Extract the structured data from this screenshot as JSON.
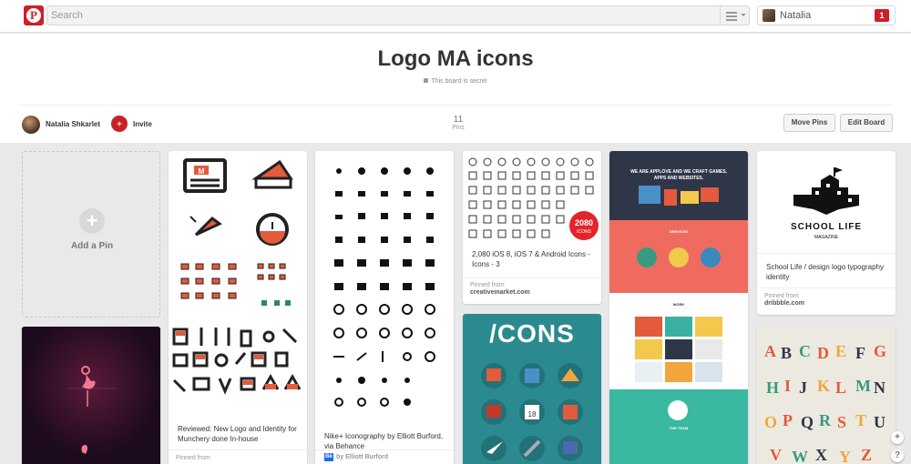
{
  "topbar": {
    "logo_letter": "P",
    "search_placeholder": "Search",
    "user_name": "Natalia",
    "notification_count": "1"
  },
  "board": {
    "title": "Logo MA icons",
    "secret_note": "This board is secret",
    "owner_name": "Natalia Shkarlet",
    "invite_label": "Invite",
    "pins_count": "11",
    "pins_label": "Pins",
    "move_pins_label": "Move Pins",
    "edit_board_label": "Edit Board"
  },
  "add_pin": {
    "label": "Add a Pin",
    "plus": "+"
  },
  "pins": [
    {
      "desc": "Reviewed: New Logo and Identity for Munchery done In-house",
      "pinned_from_label": "Pinned from",
      "source": ""
    },
    {
      "desc": "Nike+ Iconography by Elliott Burford, via Behance",
      "source": "by Elliott Burford",
      "source_badge": "Bē"
    },
    {
      "desc": "2,080 iOS 8, iOS 7 & Android Icons - Icons - 3",
      "pinned_from_label": "Pinned from",
      "source": "creativemarket.com",
      "badge_number": "2080",
      "badge_text": "ICONS"
    },
    {
      "title_text": "/CONS"
    },
    {
      "hero_text": "WE ARE APPLOVE AND WE CRAFT GAMES, APPS AND WEBSITES.",
      "section1": "SERVICES",
      "section2": "WORK",
      "section3": "THE TEAM"
    },
    {
      "desc": "School Life / design logo typography identity",
      "pinned_from_label": "Pinned from",
      "source": "dribbble.com",
      "logo_title": "SCHOOL LIFE",
      "logo_sub": "MAGAZINE"
    }
  ],
  "side_buttons": {
    "add": "+",
    "help": "?"
  },
  "colors": {
    "brand_red": "#cb2027",
    "teal": "#2b8a90",
    "coral": "#ef6b60",
    "navy": "#2f3648"
  }
}
